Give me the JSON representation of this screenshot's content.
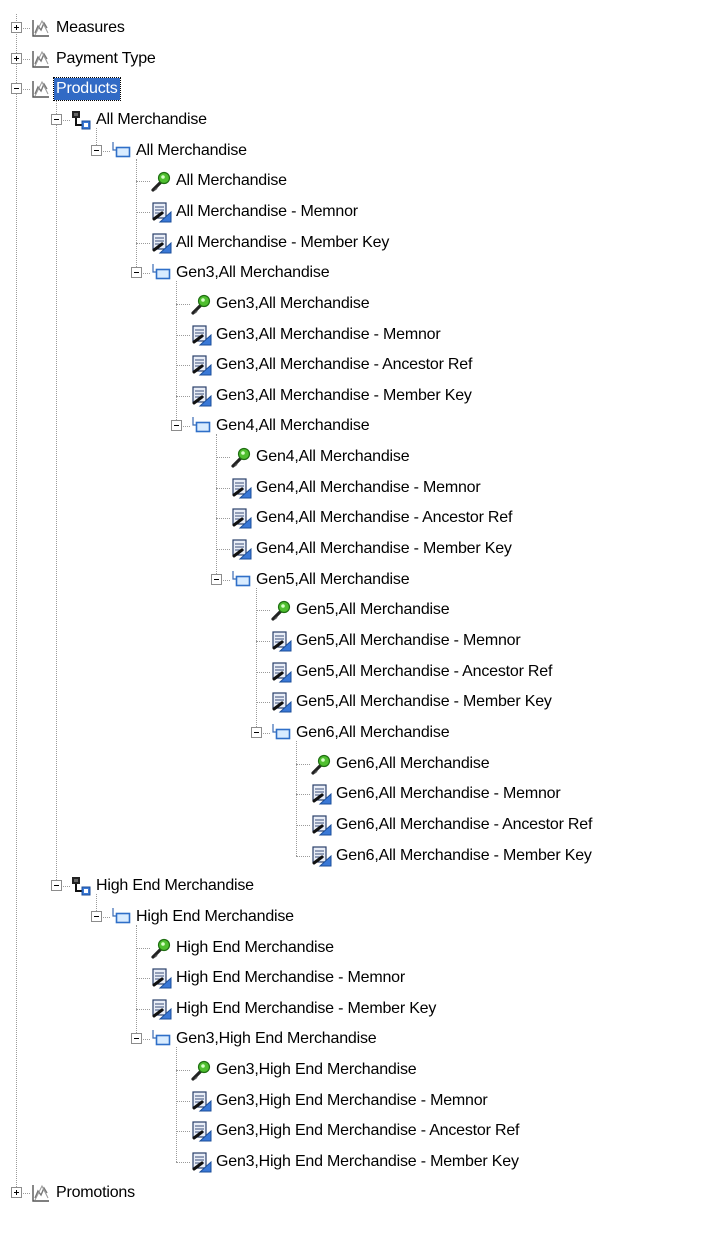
{
  "tree": {
    "nodes": [
      {
        "label": "Measures",
        "kind": "dimension",
        "level": 0,
        "state": "closed"
      },
      {
        "label": "Payment Type",
        "kind": "dimension",
        "level": 0,
        "state": "closed"
      },
      {
        "label": "Products",
        "kind": "dimension",
        "level": 0,
        "state": "open",
        "selected": true
      },
      {
        "label": "All Merchandise",
        "kind": "hierarchy",
        "level": 1,
        "state": "open"
      },
      {
        "label": "All Merchandise",
        "kind": "level",
        "level": 2,
        "state": "open"
      },
      {
        "label": "All Merchandise",
        "kind": "key",
        "level": 3
      },
      {
        "label": "All Merchandise -  Memnor",
        "kind": "attribute",
        "level": 3
      },
      {
        "label": "All Merchandise - Member Key",
        "kind": "attribute",
        "level": 3
      },
      {
        "label": "Gen3,All Merchandise",
        "kind": "level",
        "level": 3,
        "state": "open"
      },
      {
        "label": "Gen3,All Merchandise",
        "kind": "key",
        "level": 4
      },
      {
        "label": "Gen3,All Merchandise -  Memnor",
        "kind": "attribute",
        "level": 4
      },
      {
        "label": "Gen3,All Merchandise - Ancestor Ref",
        "kind": "attribute",
        "level": 4
      },
      {
        "label": "Gen3,All Merchandise - Member Key",
        "kind": "attribute",
        "level": 4
      },
      {
        "label": "Gen4,All Merchandise",
        "kind": "level",
        "level": 4,
        "state": "open"
      },
      {
        "label": "Gen4,All Merchandise",
        "kind": "key",
        "level": 5
      },
      {
        "label": "Gen4,All Merchandise -  Memnor",
        "kind": "attribute",
        "level": 5
      },
      {
        "label": "Gen4,All Merchandise - Ancestor Ref",
        "kind": "attribute",
        "level": 5
      },
      {
        "label": "Gen4,All Merchandise - Member Key",
        "kind": "attribute",
        "level": 5
      },
      {
        "label": "Gen5,All Merchandise",
        "kind": "level",
        "level": 5,
        "state": "open"
      },
      {
        "label": "Gen5,All Merchandise",
        "kind": "key",
        "level": 6
      },
      {
        "label": "Gen5,All Merchandise -  Memnor",
        "kind": "attribute",
        "level": 6
      },
      {
        "label": "Gen5,All Merchandise - Ancestor Ref",
        "kind": "attribute",
        "level": 6
      },
      {
        "label": "Gen5,All Merchandise - Member Key",
        "kind": "attribute",
        "level": 6
      },
      {
        "label": "Gen6,All Merchandise",
        "kind": "level",
        "level": 6,
        "state": "open"
      },
      {
        "label": "Gen6,All Merchandise",
        "kind": "key",
        "level": 7
      },
      {
        "label": "Gen6,All Merchandise -  Memnor",
        "kind": "attribute",
        "level": 7
      },
      {
        "label": "Gen6,All Merchandise - Ancestor Ref",
        "kind": "attribute",
        "level": 7
      },
      {
        "label": "Gen6,All Merchandise - Member Key",
        "kind": "attribute",
        "level": 7
      },
      {
        "label": "High End Merchandise",
        "kind": "hierarchy",
        "level": 1,
        "state": "open"
      },
      {
        "label": "High End Merchandise",
        "kind": "level",
        "level": 2,
        "state": "open"
      },
      {
        "label": "High End Merchandise",
        "kind": "key",
        "level": 3
      },
      {
        "label": "High End Merchandise -  Memnor",
        "kind": "attribute",
        "level": 3
      },
      {
        "label": "High End Merchandise - Member Key",
        "kind": "attribute",
        "level": 3
      },
      {
        "label": "Gen3,High End Merchandise",
        "kind": "level",
        "level": 3,
        "state": "open"
      },
      {
        "label": "Gen3,High End Merchandise",
        "kind": "key",
        "level": 4
      },
      {
        "label": "Gen3,High End Merchandise -  Memnor",
        "kind": "attribute",
        "level": 4
      },
      {
        "label": "Gen3,High End Merchandise - Ancestor Ref",
        "kind": "attribute",
        "level": 4
      },
      {
        "label": "Gen3,High End Merchandise - Member Key",
        "kind": "attribute",
        "level": 4
      },
      {
        "label": "Promotions",
        "kind": "dimension",
        "level": 0,
        "state": "closed"
      }
    ],
    "colors": {
      "selection": "#316ac5",
      "connector": "#9a9a9a",
      "icon_blue": "#3a78d6",
      "icon_green": "#4fbf2f"
    }
  }
}
